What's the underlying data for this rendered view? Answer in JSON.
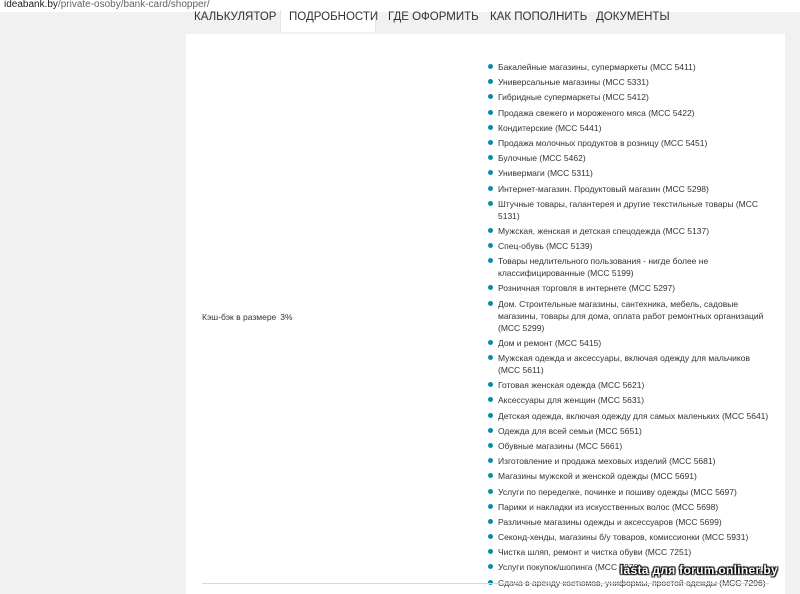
{
  "browser": {
    "url_host": "ideabank.by",
    "url_path": "/private-osoby/bank-card/shopper/"
  },
  "tabs": [
    {
      "label": "Калькулятор",
      "active": false
    },
    {
      "label": "Подробности",
      "active": true
    },
    {
      "label": "Где оформить",
      "active": false
    },
    {
      "label": "Как пополнить",
      "active": false
    },
    {
      "label": "Документы",
      "active": false
    }
  ],
  "row": {
    "label": "Кэш-бэк в размере",
    "value": "3%"
  },
  "mcc_list": [
    "Бакалейные магазины, супермаркеты (MCC 5411)",
    "Универсальные магазины (MCC 5331)",
    "Гибридные супермаркеты (MCC 5412)",
    "Продажа свежего и мороженого мяса (MCC 5422)",
    "Кондитерские (MCC 5441)",
    "Продажа молочных продуктов в розницу (MCC 5451)",
    "Булочные (MCC 5462)",
    "Универмаги (MCC 5311)",
    "Интернет-магазин. Продуктовый магазин (MCC 5298)",
    "Штучные товары, галантерея и другие текстильные товары (MCC 5131)",
    "Мужская, женская и детская спецодежда (MCC 5137)",
    "Спец-обувь (MCC 5139)",
    "Товары недлительного пользования - нигде более не классифицированные (MCC 5199)",
    "Розничная торговля в интернете (MCC 5297)",
    "Дом. Строительные магазины, сантехника, мебель, садовые магазины, товары для дома, оплата работ ремонтных организаций (MCC 5299)",
    "Дом и ремонт (MCC 5415)",
    "Мужская одежда и аксессуары, включая одежду для мальчиков (MCC 5611)",
    "Готовая женская одежда (MCC 5621)",
    "Аксессуары для женщин (MCC 5631)",
    "Детская одежда, включая одежду для самых маленьких (MCC 5641)",
    "Одежда для всей семьи (MCC 5651)",
    "Обувные магазины (MCC 5661)",
    "Изготовление и продажа меховых изделий (MCC 5681)",
    "Магазины мужской и женской одежды (MCC 5691)",
    "Услуги по переделке, починке и пошиву одежды (MCC 5697)",
    "Парики и накладки из искусственных волос (MCC 5698)",
    "Различные магазины одежды и аксессуаров (MCC 5699)",
    "Секонд-хенды, магазины б/у товаров, комиссионки (MCC 5931)",
    "Чистка шляп, ремонт и чистка обуви (MCC 7251)",
    "Услуги покупок/шопинга (MCC 7278)",
    "Сдача в аренду костюмов, униформы, простой одежды (MCC 7296)"
  ],
  "watermark": "lasta для forum.onliner.by"
}
